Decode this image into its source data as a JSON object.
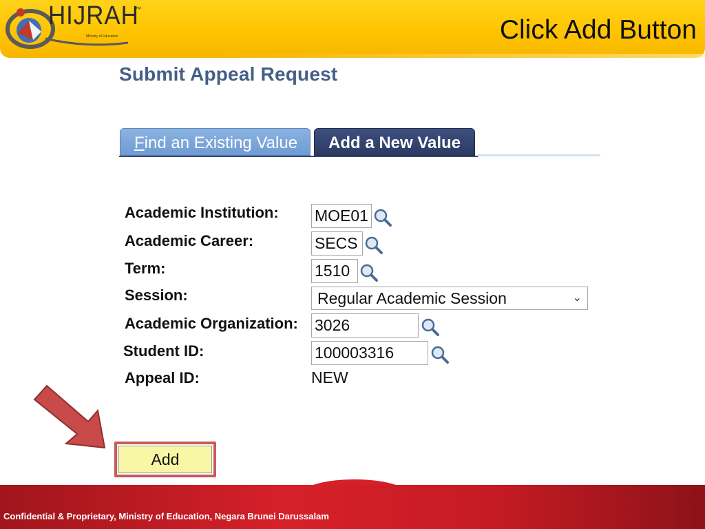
{
  "header": {
    "logo_text": "HIJRAH",
    "logo_tm": "™",
    "logo_subtext": "Ministry of Education",
    "slide_title": "Click Add Button"
  },
  "page": {
    "title": "Submit Appeal Request"
  },
  "tabs": [
    {
      "label_underlined": "F",
      "label_rest": "ind an Existing Value",
      "active": false
    },
    {
      "label": "Add a New Value",
      "active": true
    }
  ],
  "form": {
    "academic_institution": {
      "label": "Academic Institution:",
      "value": "MOE01"
    },
    "academic_career": {
      "label": "Academic Career:",
      "value": "SECS"
    },
    "term": {
      "label": "Term:",
      "value": "1510"
    },
    "session": {
      "label": "Session:",
      "selected": "Regular Academic Session"
    },
    "academic_organization": {
      "label": "Academic Organization:",
      "value": "3026"
    },
    "student_id": {
      "label": "Student ID:",
      "value": "100003316"
    },
    "appeal_id": {
      "label": "Appeal ID:",
      "value": "NEW"
    }
  },
  "actions": {
    "add_label": "Add"
  },
  "footer": {
    "text": "Confidential & Proprietary, Ministry of Education, Negara Brunei Darussalam"
  },
  "colors": {
    "header_yellow": "#ffc400",
    "title_blue": "#445f86",
    "tab_inactive": "#7aa4d8",
    "tab_active": "#34466f",
    "add_button": "#f7f7a5",
    "highlight_red": "#c85a5a",
    "footer_red": "#d62029"
  },
  "icons": {
    "lookup": "magnifier-lookup-icon",
    "dropdown": "chevron-down-icon",
    "arrow": "red-pointer-arrow-icon"
  }
}
